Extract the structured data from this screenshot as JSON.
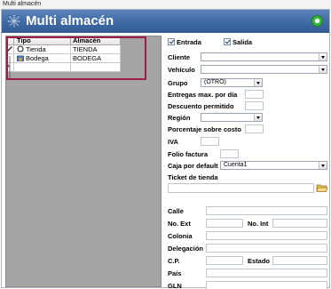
{
  "window": {
    "title": "Multi almacén"
  },
  "header": {
    "title": "Multi almacén"
  },
  "grid": {
    "columns": [
      "Tipo",
      "Almacén"
    ],
    "rows": [
      {
        "tipo": "Tienda",
        "almacen": "TIENDA"
      },
      {
        "tipo": "Bodega",
        "almacen": "BODEGA"
      }
    ]
  },
  "form": {
    "entrada_label": "Entrada",
    "salida_label": "Salida",
    "cliente_label": "Cliente",
    "vehiculo_label": "Vehículo",
    "grupo_label": "Grupo",
    "grupo_value": "(OTRO)",
    "entregas_label": "Entregas max. por día",
    "descuento_label": "Descuento permitido",
    "region_label": "Región",
    "porcentaje_label": "Porcentaje sobre costo",
    "iva_label": "IVA",
    "folio_label": "Folio factura",
    "caja_label": "Caja por default",
    "caja_value": "Cuenta1",
    "ticket_label": "Ticket de tienda",
    "calle_label": "Calle",
    "noext_label": "No. Ext",
    "noint_label": "No. Int",
    "colonia_label": "Colonia",
    "delegacion_label": "Delegación",
    "cp_label": "C.P.",
    "estado_label": "Estado",
    "pais_label": "País",
    "gln_label": "GLN"
  },
  "colors": {
    "header": "#3f6aa4",
    "grid_background": "#a5a5a5",
    "highlight": "#a01e45",
    "status": "#29a52e"
  },
  "icons": {
    "header": "asterisk-logo-icon",
    "row_tienda": "circle-icon",
    "row_bodega": "warehouse-icon",
    "ticket_browse": "folder-open-icon",
    "status": "green-status-icon"
  }
}
